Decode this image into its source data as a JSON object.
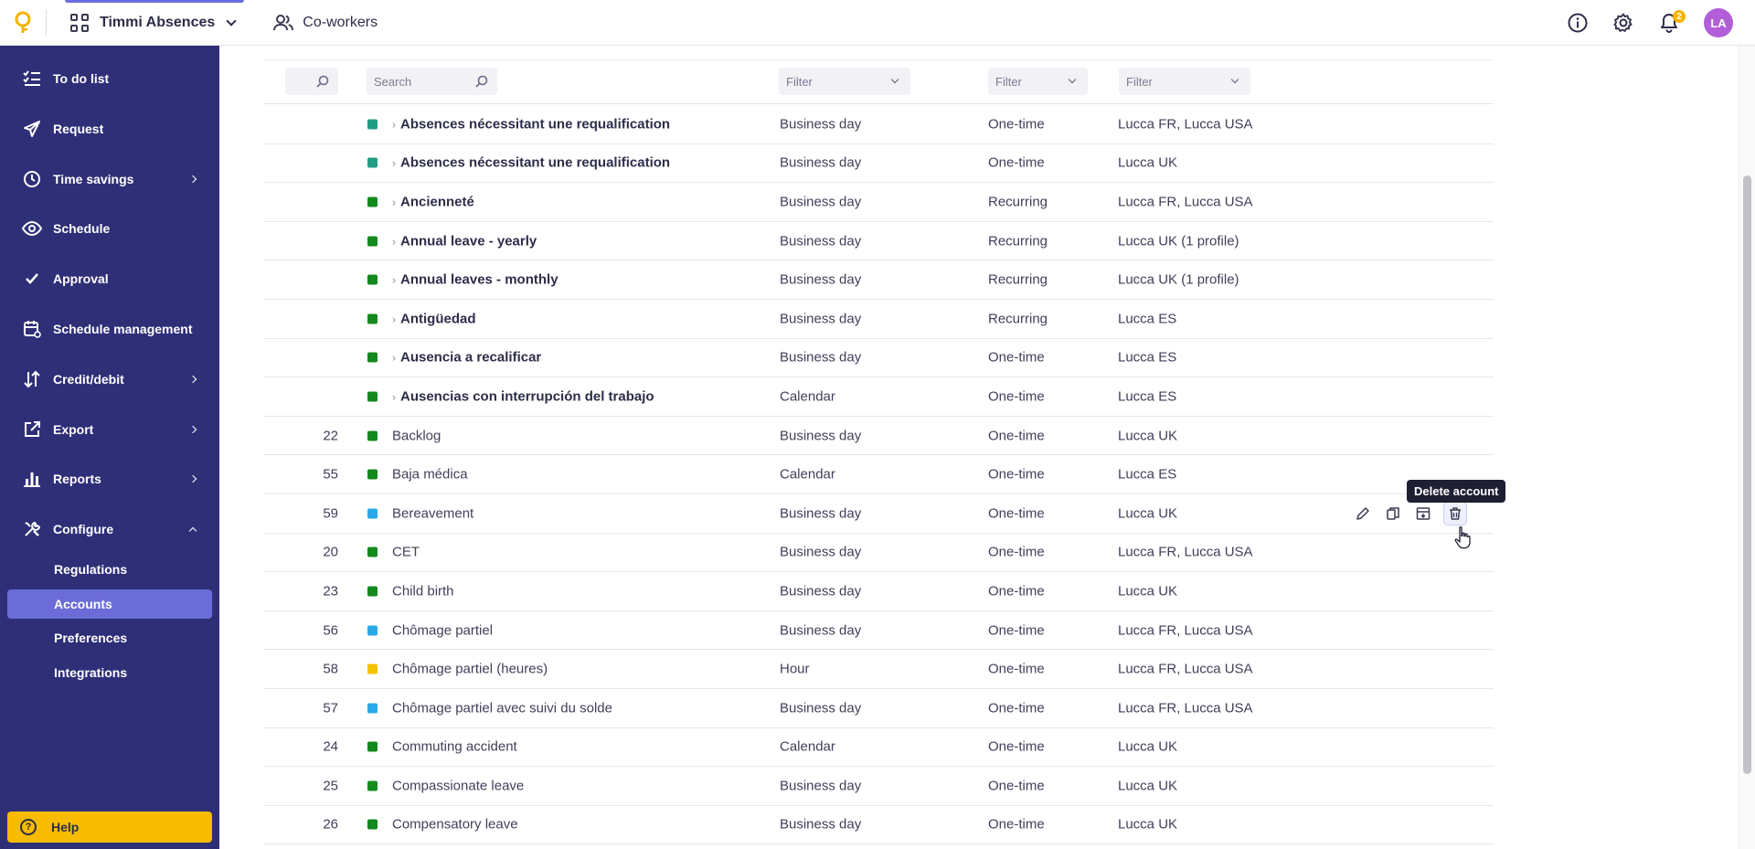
{
  "topbar": {
    "app_name": "Timmi Absences",
    "coworkers": "Co-workers",
    "notification_count": "2",
    "avatar_initials": "LA"
  },
  "sidebar": {
    "items": [
      {
        "label": "To do list",
        "icon": "checklist-icon",
        "expandable": false
      },
      {
        "label": "Request",
        "icon": "paper-plane-icon",
        "expandable": false
      },
      {
        "label": "Time savings",
        "icon": "clock-icon",
        "expandable": true
      },
      {
        "label": "Schedule",
        "icon": "eye-icon",
        "expandable": false
      },
      {
        "label": "Approval",
        "icon": "check-icon",
        "expandable": false
      },
      {
        "label": "Schedule management",
        "icon": "calendar-gear-icon",
        "expandable": false
      },
      {
        "label": "Credit/debit",
        "icon": "sort-arrows-icon",
        "expandable": true
      },
      {
        "label": "Export",
        "icon": "external-link-icon",
        "expandable": true
      },
      {
        "label": "Reports",
        "icon": "bar-chart-icon",
        "expandable": true
      },
      {
        "label": "Configure",
        "icon": "tools-icon",
        "expandable": true,
        "expanded": true
      }
    ],
    "sub_items": [
      {
        "label": "Regulations",
        "active": false
      },
      {
        "label": "Accounts",
        "active": true
      },
      {
        "label": "Preferences",
        "active": false
      },
      {
        "label": "Integrations",
        "active": false
      }
    ],
    "help_label": "Help"
  },
  "filters": {
    "search_placeholder": "Search",
    "unit_filter": "Filter",
    "type_filter": "Filter",
    "profile_filter": "Filter"
  },
  "colors": {
    "teal": "#1f9e83",
    "green": "#14891d",
    "blue": "#2aa8e8",
    "yellow": "#f5c200"
  },
  "rows": [
    {
      "id": "",
      "color": "teal",
      "name": "Absences nécessitant une requalification",
      "group": true,
      "unit": "Business day",
      "type": "One-time",
      "profiles": "Lucca FR, Lucca USA"
    },
    {
      "id": "",
      "color": "teal",
      "name": "Absences nécessitant une requalification",
      "group": true,
      "unit": "Business day",
      "type": "One-time",
      "profiles": "Lucca UK"
    },
    {
      "id": "",
      "color": "green",
      "name": "Ancienneté",
      "group": true,
      "unit": "Business day",
      "type": "Recurring",
      "profiles": "Lucca FR, Lucca USA"
    },
    {
      "id": "",
      "color": "green",
      "name": "Annual leave - yearly",
      "group": true,
      "unit": "Business day",
      "type": "Recurring",
      "profiles": "Lucca UK (1 profile)"
    },
    {
      "id": "",
      "color": "green",
      "name": "Annual leaves - monthly",
      "group": true,
      "unit": "Business day",
      "type": "Recurring",
      "profiles": "Lucca UK (1 profile)"
    },
    {
      "id": "",
      "color": "green",
      "name": "Antigüedad",
      "group": true,
      "unit": "Business day",
      "type": "Recurring",
      "profiles": "Lucca ES"
    },
    {
      "id": "",
      "color": "green",
      "name": "Ausencia a recalificar",
      "group": true,
      "unit": "Business day",
      "type": "One-time",
      "profiles": "Lucca ES"
    },
    {
      "id": "",
      "color": "green",
      "name": "Ausencias con interrupción del trabajo",
      "group": true,
      "unit": "Calendar",
      "type": "One-time",
      "profiles": "Lucca ES"
    },
    {
      "id": "22",
      "color": "green",
      "name": "Backlog",
      "group": false,
      "unit": "Business day",
      "type": "One-time",
      "profiles": "Lucca UK"
    },
    {
      "id": "55",
      "color": "green",
      "name": "Baja médica",
      "group": false,
      "unit": "Calendar",
      "type": "One-time",
      "profiles": "Lucca ES"
    },
    {
      "id": "59",
      "color": "blue",
      "name": "Bereavement",
      "group": false,
      "unit": "Business day",
      "type": "One-time",
      "profiles": "Lucca UK",
      "hovered": true
    },
    {
      "id": "20",
      "color": "green",
      "name": "CET",
      "group": false,
      "unit": "Business day",
      "type": "One-time",
      "profiles": "Lucca FR, Lucca USA"
    },
    {
      "id": "23",
      "color": "green",
      "name": "Child birth",
      "group": false,
      "unit": "Business day",
      "type": "One-time",
      "profiles": "Lucca UK"
    },
    {
      "id": "56",
      "color": "blue",
      "name": "Chômage partiel",
      "group": false,
      "unit": "Business day",
      "type": "One-time",
      "profiles": "Lucca FR, Lucca USA"
    },
    {
      "id": "58",
      "color": "yellow",
      "name": "Chômage partiel (heures)",
      "group": false,
      "unit": "Hour",
      "type": "One-time",
      "profiles": "Lucca FR, Lucca USA"
    },
    {
      "id": "57",
      "color": "blue",
      "name": "Chômage partiel avec suivi du solde",
      "group": false,
      "unit": "Business day",
      "type": "One-time",
      "profiles": "Lucca FR, Lucca USA"
    },
    {
      "id": "24",
      "color": "green",
      "name": "Commuting accident",
      "group": false,
      "unit": "Calendar",
      "type": "One-time",
      "profiles": "Lucca UK"
    },
    {
      "id": "25",
      "color": "green",
      "name": "Compassionate leave",
      "group": false,
      "unit": "Business day",
      "type": "One-time",
      "profiles": "Lucca UK"
    },
    {
      "id": "26",
      "color": "green",
      "name": "Compensatory leave",
      "group": false,
      "unit": "Business day",
      "type": "One-time",
      "profiles": "Lucca UK"
    }
  ],
  "row_actions": {
    "icons": [
      "pencil-icon",
      "copy-icon",
      "archive-icon",
      "trash-icon"
    ],
    "tooltip": "Delete account"
  }
}
